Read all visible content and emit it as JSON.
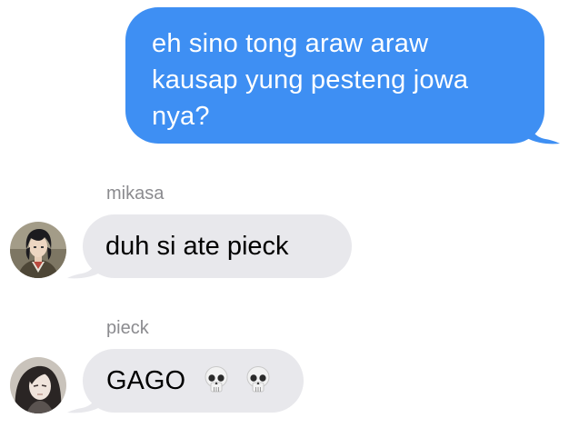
{
  "conversation": {
    "messages": [
      {
        "direction": "outgoing",
        "lines": [
          "eh sino tong araw araw",
          "kausap yung pesteng jowa",
          "nya?"
        ]
      },
      {
        "direction": "incoming",
        "sender": "mikasa",
        "avatar_icon": "mikasa-avatar",
        "text": "duh si ate pieck"
      },
      {
        "direction": "incoming",
        "sender": "pieck",
        "avatar_icon": "pieck-avatar",
        "text": "GAGO",
        "emoji_icons": [
          "skull-emoji",
          "skull-emoji"
        ]
      }
    ]
  },
  "colors": {
    "outgoing_bubble": "#3e8ff3",
    "incoming_bubble": "#e8e8ec",
    "sender_name": "#8b8b8f",
    "background": "#ffffff"
  }
}
